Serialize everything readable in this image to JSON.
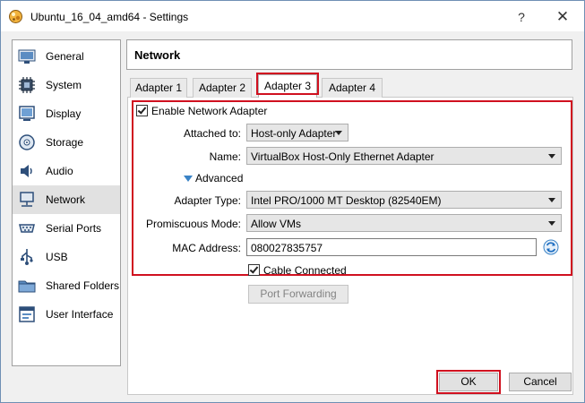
{
  "window": {
    "title": "Ubuntu_16_04_amd64 - Settings",
    "help_glyph": "?",
    "close_glyph": "✕"
  },
  "sidebar": {
    "items": [
      {
        "label": "General",
        "icon": "general-icon"
      },
      {
        "label": "System",
        "icon": "system-icon"
      },
      {
        "label": "Display",
        "icon": "display-icon"
      },
      {
        "label": "Storage",
        "icon": "storage-icon"
      },
      {
        "label": "Audio",
        "icon": "audio-icon"
      },
      {
        "label": "Network",
        "icon": "network-icon",
        "selected": true
      },
      {
        "label": "Serial Ports",
        "icon": "serial-ports-icon"
      },
      {
        "label": "USB",
        "icon": "usb-icon"
      },
      {
        "label": "Shared Folders",
        "icon": "shared-folders-icon"
      },
      {
        "label": "User Interface",
        "icon": "user-interface-icon"
      }
    ]
  },
  "header": {
    "title": "Network"
  },
  "tabs": [
    {
      "label": "Adapter 1"
    },
    {
      "label": "Adapter 2"
    },
    {
      "label": "Adapter 3",
      "active": true
    },
    {
      "label": "Adapter 4"
    }
  ],
  "adapter": {
    "enable_label": "Enable Network Adapter",
    "enabled": true,
    "attached_label": "Attached to:",
    "attached_value": "Host-only Adapter",
    "name_label": "Name:",
    "name_value": "VirtualBox Host-Only Ethernet Adapter",
    "advanced_label": "Advanced",
    "adapter_type_label": "Adapter Type:",
    "adapter_type_value": "Intel PRO/1000 MT Desktop (82540EM)",
    "promiscuous_label": "Promiscuous Mode:",
    "promiscuous_value": "Allow VMs",
    "mac_label": "MAC Address:",
    "mac_value": "080027835757",
    "cable_label": "Cable Connected",
    "cable_connected": true,
    "port_forwarding_label": "Port Forwarding"
  },
  "footer": {
    "ok_label": "OK",
    "cancel_label": "Cancel"
  },
  "colors": {
    "highlight": "#d0101f",
    "accent": "#3a83c6",
    "selected_bg": "#e1e1e1"
  }
}
